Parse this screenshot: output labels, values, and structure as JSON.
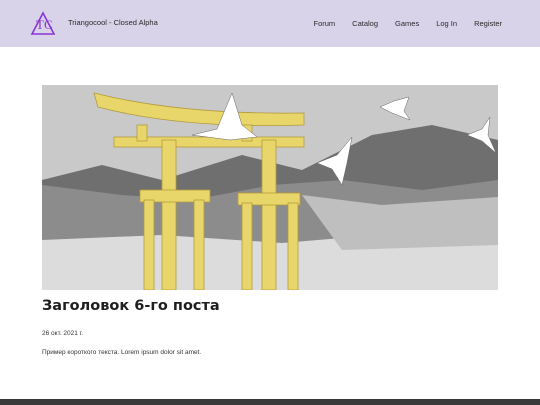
{
  "header": {
    "site_title": "Triangocool - Closed Alpha",
    "logo_text": "TC",
    "nav": [
      {
        "label": "Forum"
      },
      {
        "label": "Catalog"
      },
      {
        "label": "Games"
      },
      {
        "label": "Log In"
      },
      {
        "label": "Register"
      }
    ]
  },
  "post": {
    "title": "Заголовок 6-го поста",
    "date": "26 окт. 2021 г.",
    "excerpt": "Пример короткого текста. Lorem ipsum dolor sit amet."
  },
  "colors": {
    "header_bg": "#d8d3e8",
    "logo_purple": "#8a35d6",
    "footer": "#3a3a3a",
    "torii_yellow": "#e8d66b"
  }
}
